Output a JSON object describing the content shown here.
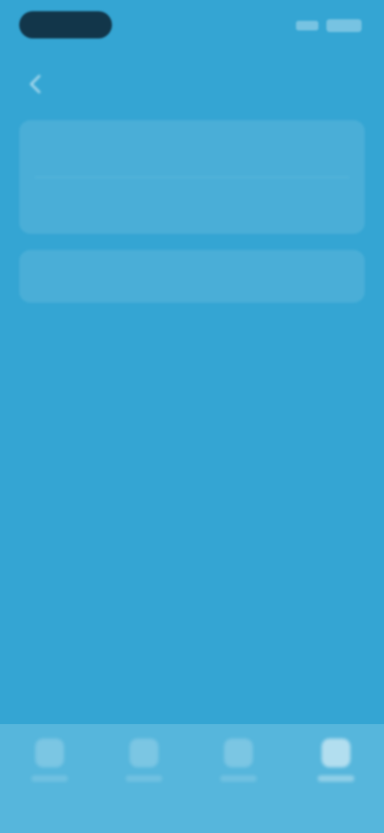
{
  "theme": {
    "background": "#34a5d3",
    "bottom_nav_background": "#56b6dc",
    "status_pill": "#12364a"
  },
  "icons": {
    "back": "chevron-left-icon",
    "nav": [
      "home-icon",
      "list-icon",
      "search-icon",
      "settings-icon"
    ]
  },
  "bottom_nav": {
    "active_index": 3
  }
}
